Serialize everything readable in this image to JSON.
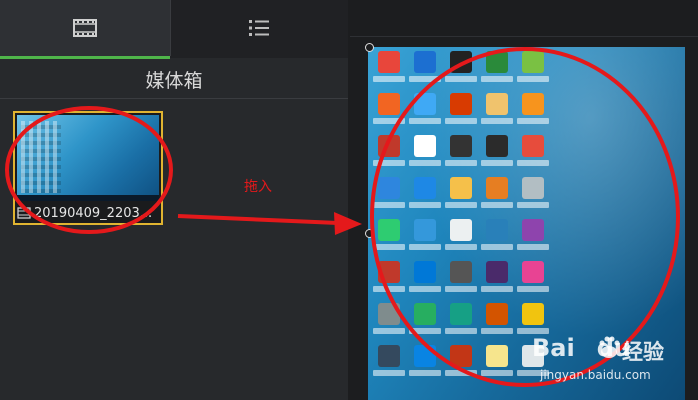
{
  "media_bin": {
    "title": "媒体箱",
    "tabs": [
      {
        "icon": "film-strip-icon"
      },
      {
        "icon": "list-icon"
      }
    ],
    "clips": [
      {
        "name": "20190409_2203..."
      }
    ]
  },
  "annotation": {
    "label": "拖入",
    "color": "#e4191b"
  },
  "watermark": {
    "brand": "Bai",
    "brand2": "du",
    "cn": "经验",
    "url": "jingyan.baidu.com"
  },
  "colors": {
    "accent_green": "#4fb54a",
    "selection_yellow": "#e0b431",
    "annotation_red": "#e4191b"
  }
}
